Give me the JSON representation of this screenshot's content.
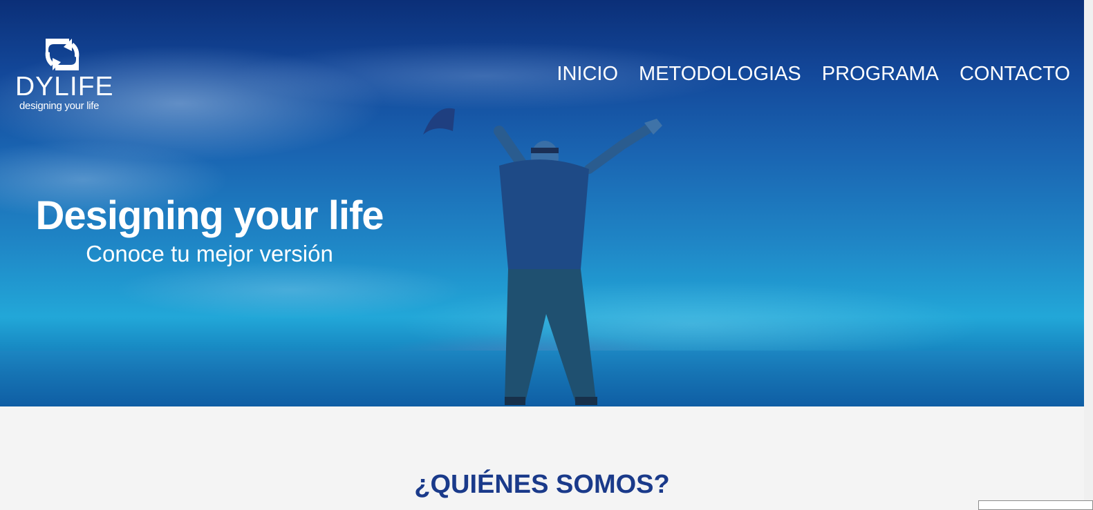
{
  "brand": {
    "name": "DYLIFE",
    "tagline": "designing your life"
  },
  "nav": {
    "items": [
      {
        "label": "INICIO"
      },
      {
        "label": "METODOLOGIAS"
      },
      {
        "label": "PROGRAMA"
      },
      {
        "label": "CONTACTO"
      }
    ]
  },
  "hero": {
    "title": "Designing your life",
    "subtitle": "Conoce tu mejor versión",
    "image_icon": "person-arms-raised-by-sea-photo"
  },
  "about": {
    "title": "¿QUIÉNES SOMOS?"
  },
  "colors": {
    "hero_sky_top": "#0b2f78",
    "hero_sea": "#1788c2",
    "section_title": "#1a3a8a",
    "page_background": "#f4f4f4"
  }
}
